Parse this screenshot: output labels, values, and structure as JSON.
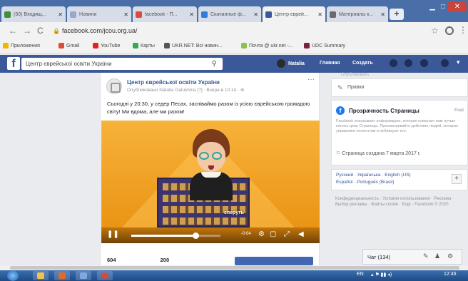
{
  "browser": {
    "tabs": [
      {
        "label": "(60) Входящ...",
        "icon": "mail-icon",
        "color": "#3d8f3d"
      },
      {
        "label": "Новини",
        "icon": "news-icon",
        "color": "#9aa7c8"
      },
      {
        "label": "facebook - П...",
        "icon": "google-icon",
        "color": "#dd4b39"
      },
      {
        "label": "Скачанные ф...",
        "icon": "download-icon",
        "color": "#2f7de1"
      },
      {
        "label": "Центр єврей...",
        "icon": "facebook-icon",
        "color": "#3b5998"
      },
      {
        "label": "Материалы к...",
        "icon": "chrome-icon",
        "color": "#6a6a6a"
      }
    ],
    "active_tab": 4,
    "url": "facebook.com/jcou.org.ua/",
    "bookmarks": [
      {
        "label": "Приложения",
        "color": "#f4b400"
      },
      {
        "label": "Gmail",
        "color": "#dd4b39"
      },
      {
        "label": "YouTube",
        "color": "#e62117"
      },
      {
        "label": "Карты",
        "color": "#34a853"
      },
      {
        "label": "UKR.NET: Всі новин...",
        "color": "#555555"
      },
      {
        "label": "Почта @ ukr.net -...",
        "color": "#8bc34a"
      },
      {
        "label": "UDC Summary",
        "color": "#7b1f3a"
      }
    ]
  },
  "facebook": {
    "search_value": "Центр єврейської освіти України",
    "profile_name": "Natalia",
    "nav_home": "Главная",
    "nav_create": "Создать",
    "brand_color": "#3b5998"
  },
  "post": {
    "faint_top": "Опубликовано",
    "page_name": "Центр єврейської освіти України",
    "meta": "Опубликовано Natalia Galushina [?] · Вчера в 10:14 · ",
    "text": "Сьогодні у 20:30, у седер Песах, заспіваймо разом із усією єврейською громадою світу! Ми вдома, але ми разом!",
    "video": {
      "caption": "сперуть",
      "progress": 0.72,
      "time": "-0:04"
    },
    "stat1": "604",
    "stat2": "200"
  },
  "sidebar": {
    "faint_top": "Опубликовать",
    "suggest_edit": "Правки",
    "transparency_title": "Прозрачность Страницы",
    "transparency_edit": "Ещё",
    "transparency_desc": "Facebook показывает информацию, которая помогает вам лучше понять цель Страницы. Просматривайте действия людей, которые управляют контентом и публикуют его.",
    "created": "Страница создана 7 марта 2017 г.",
    "languages_line1": "Русский · Українська · English (US)",
    "languages_line2": "Español · Português (Brasil)",
    "footer": "Конфиденциальность · Условия использования · Реклама · Выбор рекламы · Файлы cookie · Ещё · Facebook © 2020",
    "chat_label": "Чат (134)"
  },
  "taskbar": {
    "lang": "EN",
    "clock": "12:46"
  }
}
